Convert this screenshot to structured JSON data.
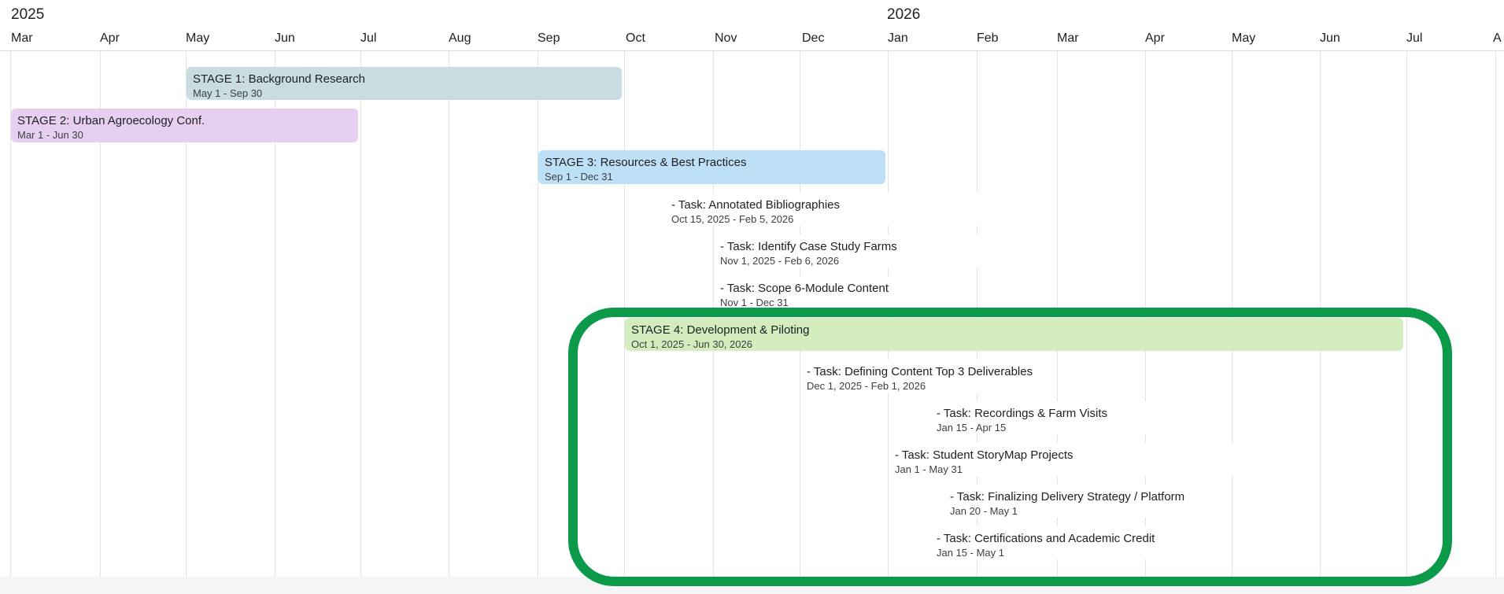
{
  "colors": {
    "stage1": "#c8dce2",
    "stage2": "#e7cff1",
    "stage3": "#bee0f7",
    "stage4": "#d3edbe",
    "task": "#ffffff",
    "highlight_ring": "#0b9a4a",
    "gridline": "#e3e3e3"
  },
  "timeline": {
    "years": [
      "2025",
      "2026"
    ],
    "months": [
      "Mar",
      "Apr",
      "May",
      "Jun",
      "Jul",
      "Aug",
      "Sep",
      "Oct",
      "Nov",
      "Dec",
      "Jan",
      "Feb",
      "Mar",
      "Apr",
      "May",
      "Jun",
      "Jul",
      "A"
    ]
  },
  "bars": [
    {
      "kind": "stage",
      "color_key": "stage1",
      "title": "STAGE 1: Background Research",
      "dates": "May 1 - Sep 30"
    },
    {
      "kind": "stage",
      "color_key": "stage2",
      "title": "STAGE 2: Urban Agroecology Conf.",
      "dates": "Mar 1 - Jun 30"
    },
    {
      "kind": "stage",
      "color_key": "stage3",
      "title": "STAGE 3: Resources & Best Practices",
      "dates": "Sep 1 - Dec 31"
    },
    {
      "kind": "task",
      "color_key": "task",
      "title": "- Task: Annotated Bibliographies",
      "dates": "Oct 15, 2025 - Feb 5, 2026"
    },
    {
      "kind": "task",
      "color_key": "task",
      "title": "- Task: Identify Case Study Farms",
      "dates": "Nov 1, 2025 - Feb 6, 2026"
    },
    {
      "kind": "task",
      "color_key": "task",
      "title": "- Task: Scope 6-Module Content",
      "dates": "Nov 1 - Dec 31"
    },
    {
      "kind": "stage",
      "color_key": "stage4",
      "title": "STAGE 4: Development & Piloting",
      "dates": "Oct 1, 2025 - Jun 30, 2026"
    },
    {
      "kind": "task",
      "color_key": "task",
      "title": "- Task: Defining Content Top 3 Deliverables",
      "dates": "Dec 1, 2025 - Feb 1, 2026"
    },
    {
      "kind": "task",
      "color_key": "task",
      "title": "- Task: Recordings & Farm Visits",
      "dates": "Jan 15 - Apr 15"
    },
    {
      "kind": "task",
      "color_key": "task",
      "title": "- Task: Student StoryMap Projects",
      "dates": "Jan 1 - May 31"
    },
    {
      "kind": "task",
      "color_key": "task",
      "title": "- Task: Finalizing Delivery Strategy / Platform",
      "dates": "Jan 20 - May 1"
    },
    {
      "kind": "task",
      "color_key": "task",
      "title": "- Task: Certifications and Academic Credit",
      "dates": "Jan 15 - May 1"
    }
  ]
}
